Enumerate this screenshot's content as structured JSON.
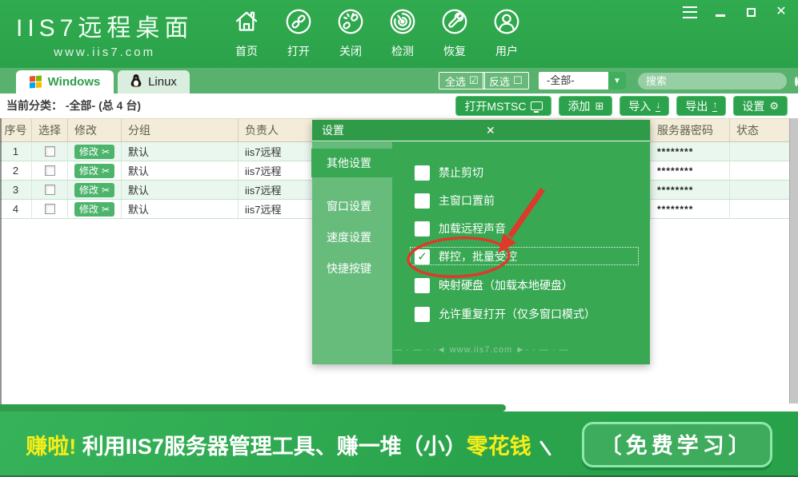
{
  "window": {
    "close_glyph": "✕"
  },
  "header": {
    "logo_title": "IIS7远程桌面",
    "logo_subtitle": "www.iis7.com",
    "nav": [
      {
        "label": "首页",
        "icon": "home-icon"
      },
      {
        "label": "打开",
        "icon": "link-icon"
      },
      {
        "label": "关闭",
        "icon": "broken-link-icon"
      },
      {
        "label": "检测",
        "icon": "radar-icon"
      },
      {
        "label": "恢复",
        "icon": "wrench-icon"
      },
      {
        "label": "用户",
        "icon": "user-icon"
      }
    ]
  },
  "tabs": {
    "windows": "Windows",
    "linux": "Linux"
  },
  "filter_bar": {
    "select_all": "全选",
    "select_all_icon": "☑",
    "invert": "反选",
    "invert_icon": "☐",
    "category": "-全部-",
    "dropdown_arrow": "▼",
    "search_placeholder": "搜索"
  },
  "toolbar": {
    "current_category": "当前分类： -全部- (总 4 台)",
    "mstsc": "打开MSTSC",
    "add": "添加",
    "add_icon": "⊞",
    "import": "导入",
    "import_icon": "↓",
    "export": "导出",
    "export_icon": "↑",
    "settings": "设置",
    "settings_icon": "⚙"
  },
  "table": {
    "headers": [
      "序号",
      "选择",
      "修改",
      "分组",
      "负责人",
      "服务器密码",
      "状态"
    ],
    "modify_label": "修改",
    "modify_icon": "✂",
    "rows": [
      {
        "no": "1",
        "group": "默认",
        "owner": "iis7远程",
        "password": "********",
        "status": ""
      },
      {
        "no": "2",
        "group": "默认",
        "owner": "iis7远程",
        "password": "********",
        "status": ""
      },
      {
        "no": "3",
        "group": "默认",
        "owner": "iis7远程",
        "password": "********",
        "status": ""
      },
      {
        "no": "4",
        "group": "默认",
        "owner": "iis7远程",
        "password": "********",
        "status": ""
      }
    ]
  },
  "dialog": {
    "title": "设置",
    "close_glyph": "✕",
    "tabs": [
      "其他设置",
      "窗口设置",
      "速度设置",
      "快捷按键"
    ],
    "active_tab": "其他设置",
    "check_glyph": "✓",
    "options": [
      {
        "label": "禁止剪切",
        "checked": false
      },
      {
        "label": "主窗口置前",
        "checked": false
      },
      {
        "label": "加载远程声音",
        "checked": false
      },
      {
        "label": "群控，批量受控",
        "checked": true
      },
      {
        "label": "映射硬盘（加载本地硬盘）",
        "checked": false
      },
      {
        "label": "允许重复打开（仅多窗口模式）",
        "checked": false
      }
    ],
    "watermark": "— · — · ·◄ www.iis7.com ►· · — · —"
  },
  "banner": {
    "highlight_prefix": "赚啦!",
    "text": "利用IIS7服务器管理工具、赚一堆（小）",
    "highlight_suffix": "零花钱",
    "cta": "〔免费学习〕"
  },
  "colors": {
    "primary_green": "#2fa94d",
    "accent_yellow": "#f7ee18",
    "annotation_red": "#dd3a2c"
  }
}
